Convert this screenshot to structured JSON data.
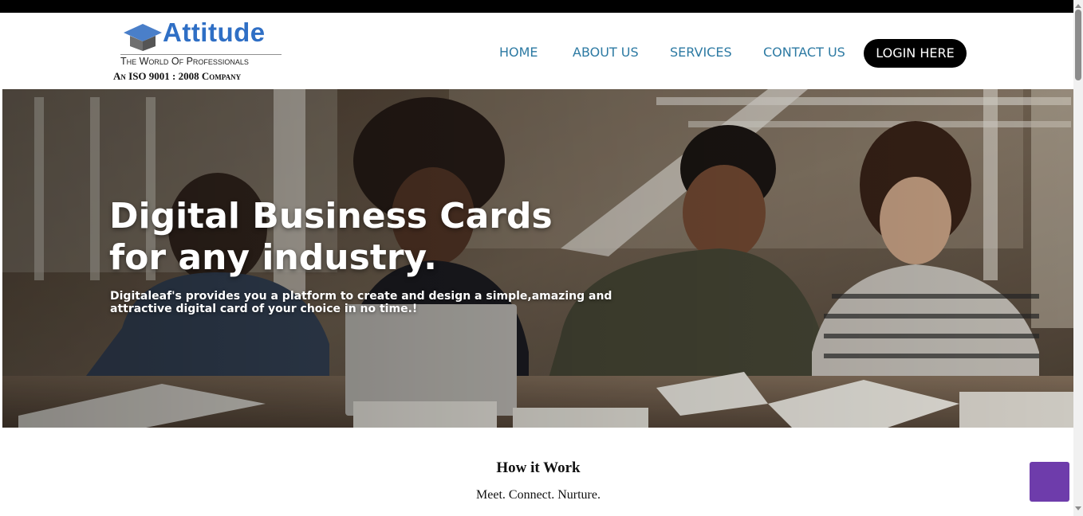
{
  "logo": {
    "name": "Attitude",
    "tagline": "The World Of Professionals",
    "iso": "An ISO 9001 : 2008 Company"
  },
  "nav": {
    "items": [
      {
        "label": "HOME"
      },
      {
        "label": "ABOUT US"
      },
      {
        "label": "SERVICES"
      },
      {
        "label": "CONTACT US"
      }
    ],
    "login_label": "LOGIN HERE"
  },
  "hero": {
    "title": "Digital Business Cards for any industry.",
    "subtitle": "Digitaleaf's provides you a platform to create and design a simple,amazing and attractive digital card of your choice in no time.!"
  },
  "how_it_works": {
    "title": "How it Work",
    "subtitle": "Meet. Connect. Nurture."
  },
  "colors": {
    "nav_link": "#2d7aa3",
    "logo_blue": "#2f6fc5",
    "login_bg": "#000000",
    "float_button": "#6e3cab"
  },
  "icons": {
    "float_button": "chat-icon"
  }
}
